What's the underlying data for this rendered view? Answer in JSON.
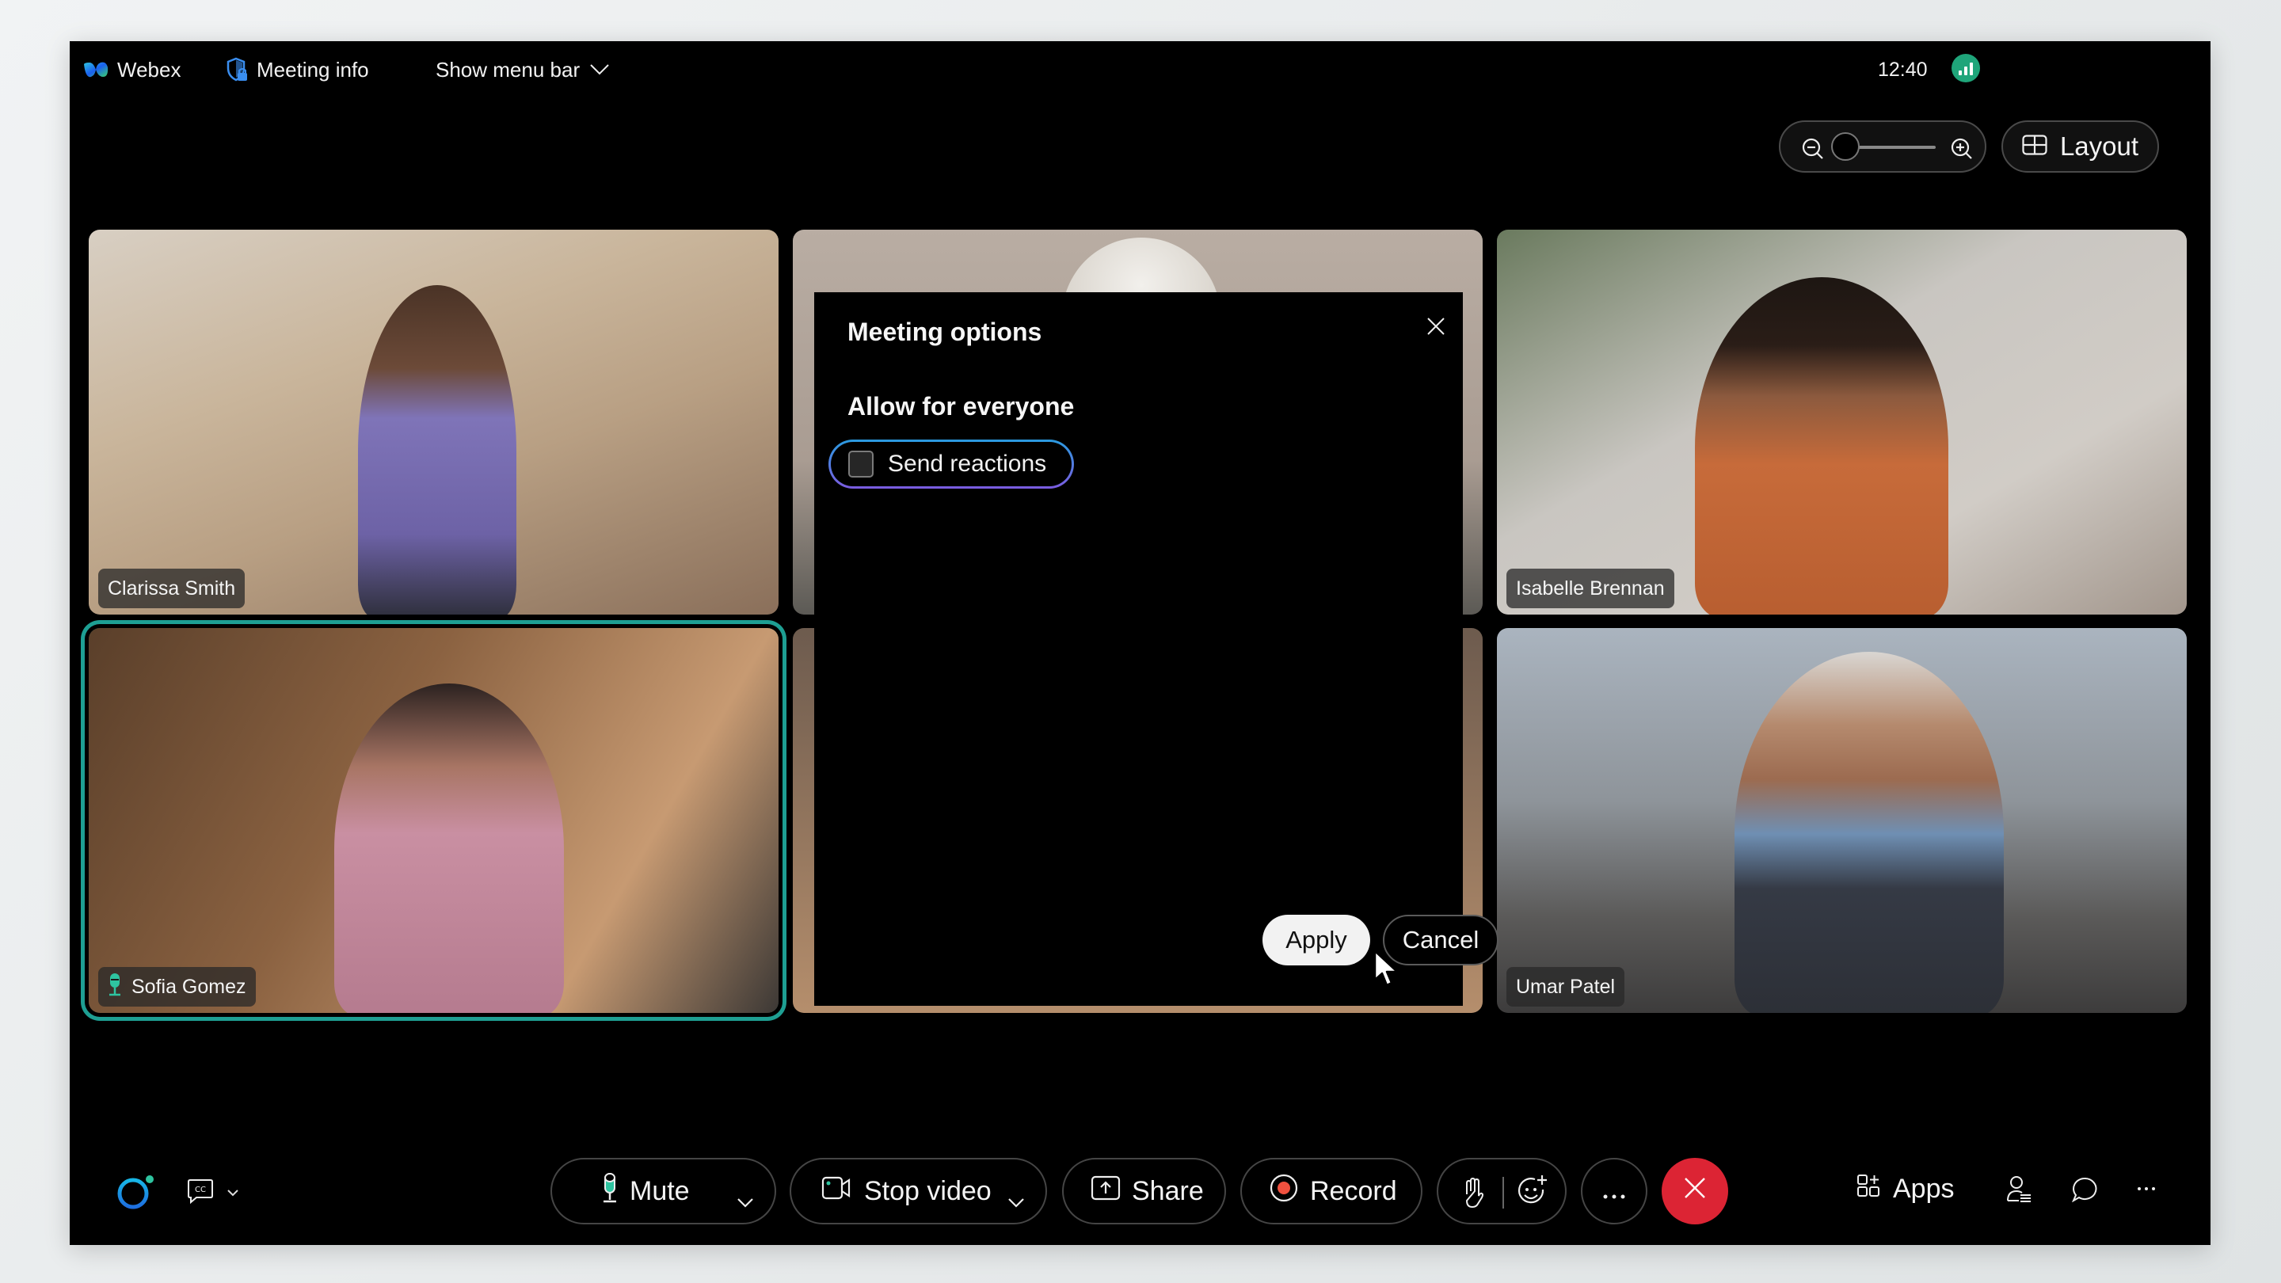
{
  "topbar": {
    "app_name": "Webex",
    "meeting_info": "Meeting info",
    "show_menu_bar": "Show menu bar",
    "time": "12:40",
    "connection_icon": "signal-strength-icon"
  },
  "view_controls": {
    "zoom_level": 0,
    "layout_label": "Layout"
  },
  "participants": [
    {
      "name": "Clarissa Smith",
      "active_speaker": false,
      "show_mic": false
    },
    {
      "name": "",
      "active_speaker": false,
      "show_mic": false
    },
    {
      "name": "Isabelle Brennan",
      "active_speaker": false,
      "show_mic": false
    },
    {
      "name": "Sofia Gomez",
      "active_speaker": true,
      "show_mic": true
    },
    {
      "name": "",
      "active_speaker": false,
      "show_mic": false
    },
    {
      "name": "Umar Patel",
      "active_speaker": false,
      "show_mic": false
    }
  ],
  "dialog": {
    "title": "Meeting options",
    "section_title": "Allow for everyone",
    "options": [
      {
        "label": "Send reactions",
        "checked": false
      }
    ],
    "apply_label": "Apply",
    "cancel_label": "Cancel"
  },
  "toolbar": {
    "mute_label": "Mute",
    "stop_video_label": "Stop video",
    "share_label": "Share",
    "record_label": "Record",
    "apps_label": "Apps",
    "colors": {
      "end_call": "#dc2434",
      "record_dot": "#f0513f",
      "active_mic": "#2ec4a0",
      "active_border": "#1e9f93"
    }
  }
}
